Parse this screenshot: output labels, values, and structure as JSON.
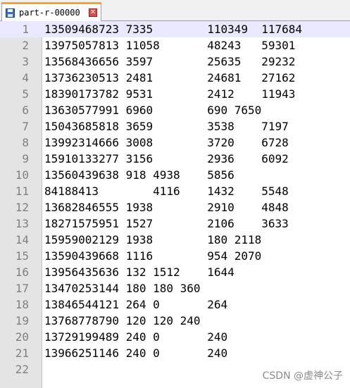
{
  "tab": {
    "label": "part-r-00000",
    "save_icon": "floppy-disk-icon",
    "close_icon": "close-icon",
    "close_glyph": "✕"
  },
  "colors": {
    "tab_accent": "#f5a623",
    "current_line": "#e8e8ff",
    "gutter": "#e4e4e4",
    "line_number": "#808080"
  },
  "editor": {
    "current_line": 1,
    "lines": [
      {
        "number": "1",
        "text": "13509468723 7335\t110349\t117684"
      },
      {
        "number": "2",
        "text": "13975057813 11058\t48243\t59301"
      },
      {
        "number": "3",
        "text": "13568436656 3597\t25635\t29232"
      },
      {
        "number": "4",
        "text": "13736230513 2481\t24681\t27162"
      },
      {
        "number": "5",
        "text": "18390173782 9531\t2412\t11943"
      },
      {
        "number": "6",
        "text": "13630577991 6960\t690 7650"
      },
      {
        "number": "7",
        "text": "15043685818 3659\t3538\t7197"
      },
      {
        "number": "8",
        "text": "13992314666 3008\t3720\t6728"
      },
      {
        "number": "9",
        "text": "15910133277 3156\t2936\t6092"
      },
      {
        "number": "10",
        "text": "13560439638 918 4938\t5856"
      },
      {
        "number": "11",
        "text": "84188413\t4116\t1432\t5548"
      },
      {
        "number": "12",
        "text": "13682846555 1938\t2910\t4848"
      },
      {
        "number": "13",
        "text": "18271575951 1527\t2106\t3633"
      },
      {
        "number": "14",
        "text": "15959002129 1938\t180 2118"
      },
      {
        "number": "15",
        "text": "13590439668 1116\t954 2070"
      },
      {
        "number": "16",
        "text": "13956435636 132 1512\t1644"
      },
      {
        "number": "17",
        "text": "13470253144 180 180 360"
      },
      {
        "number": "18",
        "text": "13846544121 264 0\t264"
      },
      {
        "number": "19",
        "text": "13768778790 120 120 240"
      },
      {
        "number": "20",
        "text": "13729199489 240 0\t240"
      },
      {
        "number": "21",
        "text": "13966251146 240 0\t240"
      },
      {
        "number": "22",
        "text": ""
      }
    ]
  },
  "watermark": "CSDN @虚神公子"
}
